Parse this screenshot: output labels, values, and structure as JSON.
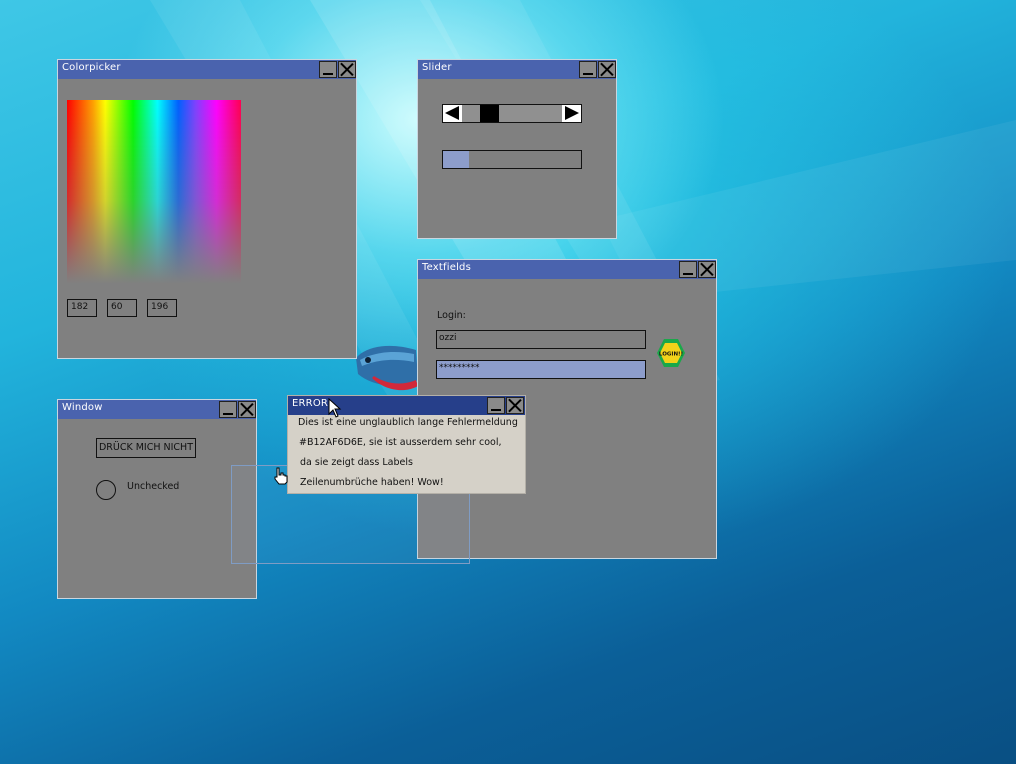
{
  "windows": {
    "colorpicker": {
      "title": "Colorpicker",
      "values": {
        "r": "182",
        "g": "60",
        "b": "196"
      }
    },
    "slider": {
      "title": "Slider",
      "slider_value_fraction": 0.22,
      "progress_fraction": 0.19
    },
    "textfields": {
      "title": "Textfields",
      "login_label": "Login:",
      "username_value": "ozzi",
      "password_value": "*********",
      "login_button_label": "LOGIN!!"
    },
    "window": {
      "title": "Window",
      "button_label": "DRÜCK MICH NICHT",
      "radio_label": "Unchecked"
    },
    "error": {
      "title": "ERROR",
      "lines": [
        "Dies ist eine unglaublich lange Fehlermeldung",
        "#B12AF6D6E, sie ist ausserdem sehr cool,",
        "da sie zeigt dass Labels",
        "Zeilenumbrüche haben! Wow!"
      ]
    }
  },
  "colors": {
    "titlebar": "#4a63ae",
    "error_titlebar": "#263f8a",
    "window_body": "#808080",
    "highlight": "#8d9dcb"
  },
  "icons": {
    "minimize": "minimize-icon",
    "close": "close-icon",
    "cursor_arrow": "arrow-cursor-icon",
    "cursor_hand": "hand-cursor-icon"
  }
}
